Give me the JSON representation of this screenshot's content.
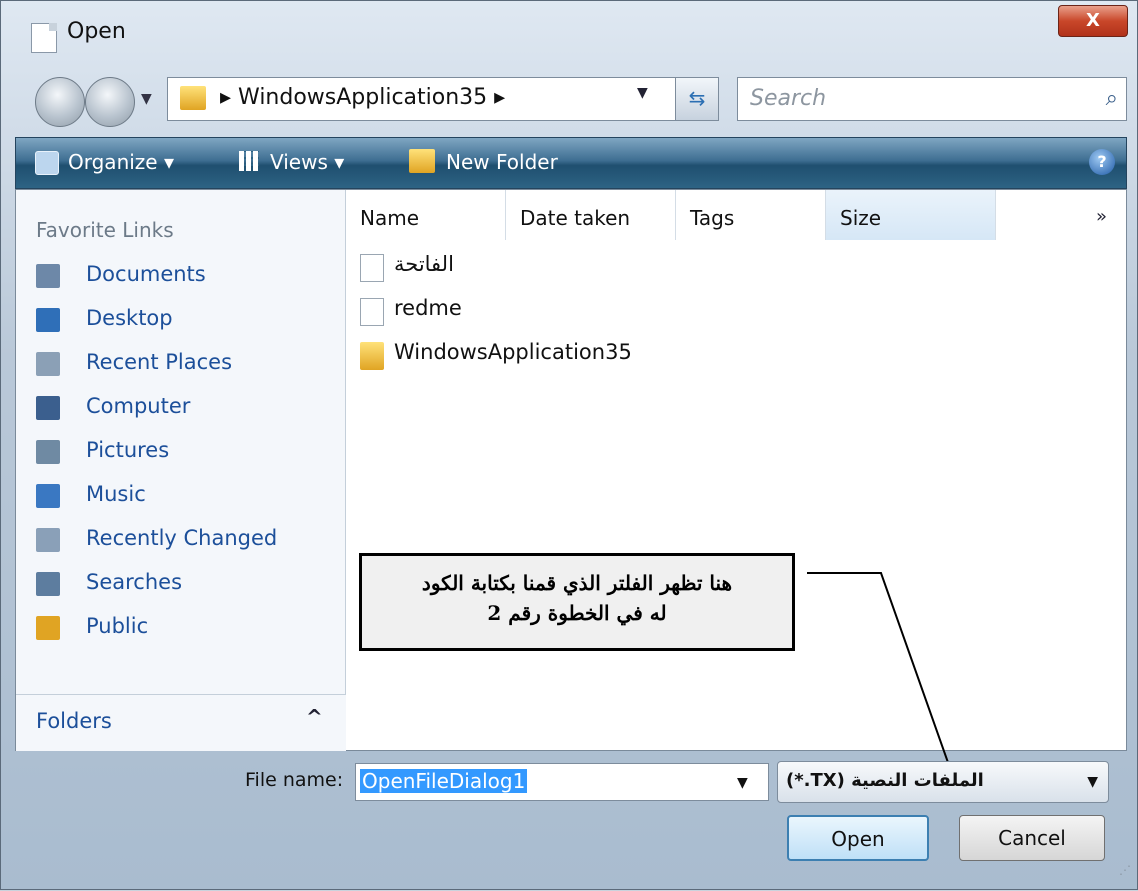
{
  "window": {
    "title": "Open",
    "close_glyph": "X"
  },
  "address_bar": {
    "path": "WindowsApplication35",
    "separator": "▸",
    "search_placeholder": "Search"
  },
  "toolbar": {
    "organize": "Organize ▾",
    "views": "Views ▾",
    "new_folder": "New Folder"
  },
  "sidebar": {
    "favorites_title": "Favorite Links",
    "items": [
      {
        "label": "Documents",
        "icon": "documents-icon",
        "color": "#6d88a8"
      },
      {
        "label": "Desktop",
        "icon": "desktop-icon",
        "color": "#2f6fb8"
      },
      {
        "label": "Recent Places",
        "icon": "recent-places-icon",
        "color": "#8ba0b6"
      },
      {
        "label": "Computer",
        "icon": "computer-icon",
        "color": "#3b5f8e"
      },
      {
        "label": "Pictures",
        "icon": "pictures-icon",
        "color": "#6f8aa3"
      },
      {
        "label": "Music",
        "icon": "music-icon",
        "color": "#3a78c2"
      },
      {
        "label": "Recently Changed",
        "icon": "recently-changed-icon",
        "color": "#8aa0b8"
      },
      {
        "label": "Searches",
        "icon": "searches-icon",
        "color": "#5d7d9f"
      },
      {
        "label": "Public",
        "icon": "public-folder-icon",
        "color": "#e0a423"
      }
    ],
    "folders_label": "Folders",
    "folders_chevron": "^"
  },
  "file_list": {
    "columns": [
      "Name",
      "Date taken",
      "Tags",
      "Size"
    ],
    "more_columns": "»",
    "files": [
      {
        "name": "الفاتحة",
        "icon": "text-file-icon",
        "type": "doc"
      },
      {
        "name": "redme",
        "icon": "text-file-icon",
        "type": "doc"
      },
      {
        "name": "WindowsApplication35",
        "icon": "folder-icon",
        "type": "folder"
      }
    ]
  },
  "annotation": {
    "line1": "هنا تظهر الفلتر الذي قمنا بكتابة الكود",
    "line2": "له في الخطوة رقم 2"
  },
  "bottom": {
    "file_name_label": "File name:",
    "file_name_value": "OpenFileDialog1",
    "filter_value": "(*.TX) الملفات النصية",
    "open_button": "Open",
    "cancel_button": "Cancel"
  }
}
